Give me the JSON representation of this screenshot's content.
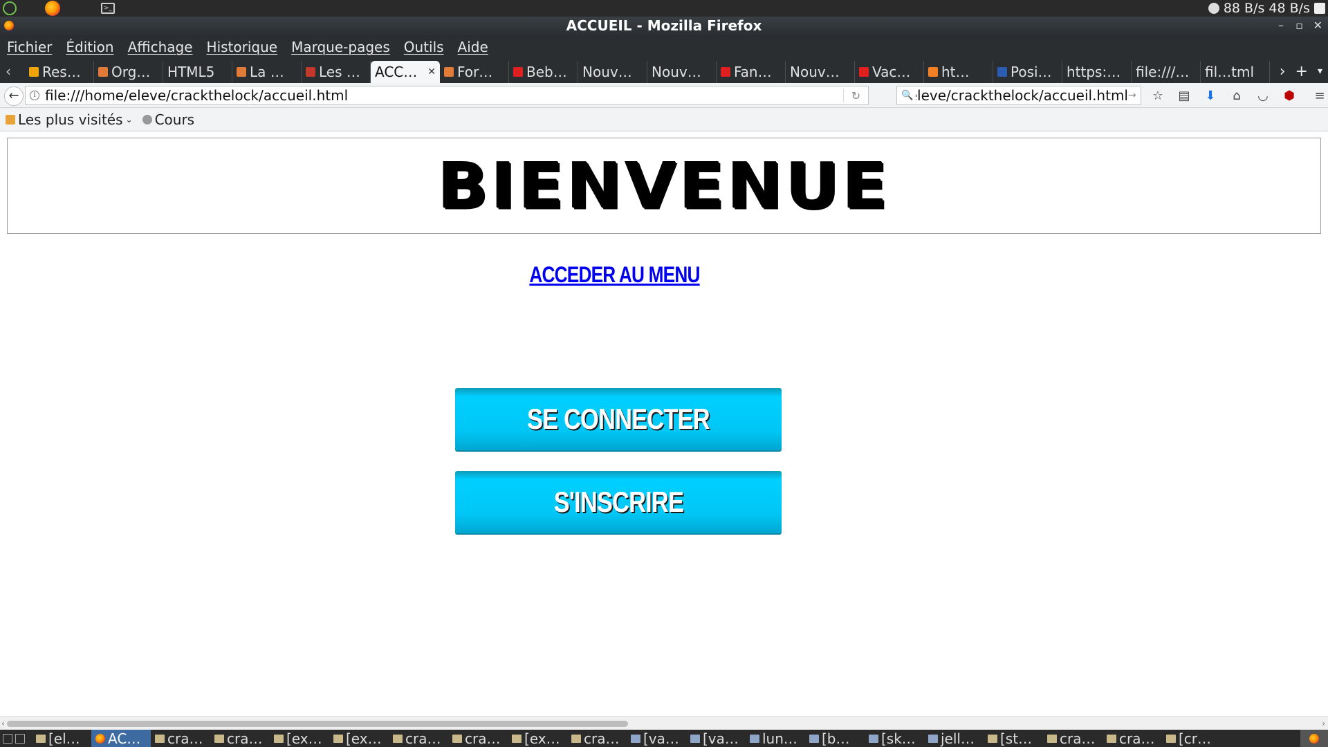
{
  "window": {
    "title": "ACCUEIL - Mozilla Firefox",
    "minimize": "–",
    "maximize": "▫",
    "close": "✕"
  },
  "top_panel": {
    "net_text": "88 B/s 48 B/s"
  },
  "menubar": {
    "items": [
      "Fichier",
      "Édition",
      "Affichage",
      "Historique",
      "Marque-pages",
      "Outils",
      "Aide"
    ]
  },
  "tabs": [
    {
      "label": "Res…",
      "favicon": "warning-icon",
      "color": "#f0a30a"
    },
    {
      "label": "Org…",
      "favicon": "orange-swirl-icon",
      "color": "#e07b39"
    },
    {
      "label": "HTML5",
      "favicon": "",
      "color": ""
    },
    {
      "label": "La …",
      "favicon": "orange-icon",
      "color": "#e07b39"
    },
    {
      "label": "Les …",
      "favicon": "red-arrow-icon",
      "color": "#c0392b"
    },
    {
      "label": "ACC…",
      "favicon": "",
      "color": "",
      "active": true
    },
    {
      "label": "For…",
      "favicon": "orange-swirl-icon",
      "color": "#e07b39"
    },
    {
      "label": "Beb…",
      "favicon": "d-icon",
      "color": "#e01f1f"
    },
    {
      "label": "Nouv…",
      "favicon": "",
      "color": ""
    },
    {
      "label": "Nouv…",
      "favicon": "",
      "color": ""
    },
    {
      "label": "Fan…",
      "favicon": "d-icon",
      "color": "#e01f1f"
    },
    {
      "label": "Nouv…",
      "favicon": "",
      "color": ""
    },
    {
      "label": "Vac…",
      "favicon": "d-icon",
      "color": "#e01f1f"
    },
    {
      "label": "ht…",
      "favicon": "stack-icon",
      "color": "#f48024"
    },
    {
      "label": "Posi…",
      "favicon": "hc-icon",
      "color": "#2a5db0"
    },
    {
      "label": "https:…",
      "favicon": "",
      "color": ""
    },
    {
      "label": "file:///…",
      "favicon": "",
      "color": ""
    },
    {
      "label": "fil…tml",
      "favicon": "",
      "color": ""
    }
  ],
  "navbar": {
    "url": "file:///home/eleve/crackthelock/accueil.html",
    "search_value": "eleve/crackthelock/accueil.html"
  },
  "bookmarks": [
    {
      "label": "Les plus visités",
      "icon": "folder-icon",
      "dropdown": true
    },
    {
      "label": "Cours",
      "icon": "globe-icon",
      "dropdown": false
    }
  ],
  "page": {
    "title": "BIENVENUE",
    "menu_link": "ACCEDER AU MENU",
    "connect_button": "SE CONNECTER",
    "register_button": "S'INSCRIRE",
    "button_color": "#00c8f8",
    "link_color": "#0000ee"
  },
  "taskbar": {
    "tasks": [
      {
        "label": "[el…",
        "icon": "terminal-icon"
      },
      {
        "label": "AC…",
        "icon": "firefox-icon",
        "active": true
      },
      {
        "label": "cra…",
        "icon": "folder-icon"
      },
      {
        "label": "cra…",
        "icon": "folder-icon"
      },
      {
        "label": "[ex…",
        "icon": "folder-icon"
      },
      {
        "label": "[ex…",
        "icon": "folder-icon"
      },
      {
        "label": "cra…",
        "icon": "folder-icon"
      },
      {
        "label": "cra…",
        "icon": "folder-icon"
      },
      {
        "label": "[ex…",
        "icon": "folder-icon"
      },
      {
        "label": "cra…",
        "icon": "folder-icon"
      },
      {
        "label": "[va…",
        "icon": "vm-icon"
      },
      {
        "label": "[va…",
        "icon": "vm-icon"
      },
      {
        "label": "lun…",
        "icon": "vm-icon"
      },
      {
        "label": "[b…",
        "icon": "vm-icon"
      },
      {
        "label": "[sk…",
        "icon": "vm-icon"
      },
      {
        "label": "jell…",
        "icon": "vm-icon"
      },
      {
        "label": "[st…",
        "icon": "folder-icon"
      },
      {
        "label": "cra…",
        "icon": "folder-icon"
      },
      {
        "label": "cra…",
        "icon": "folder-icon"
      },
      {
        "label": "[cr…",
        "icon": "folder-icon"
      }
    ]
  }
}
